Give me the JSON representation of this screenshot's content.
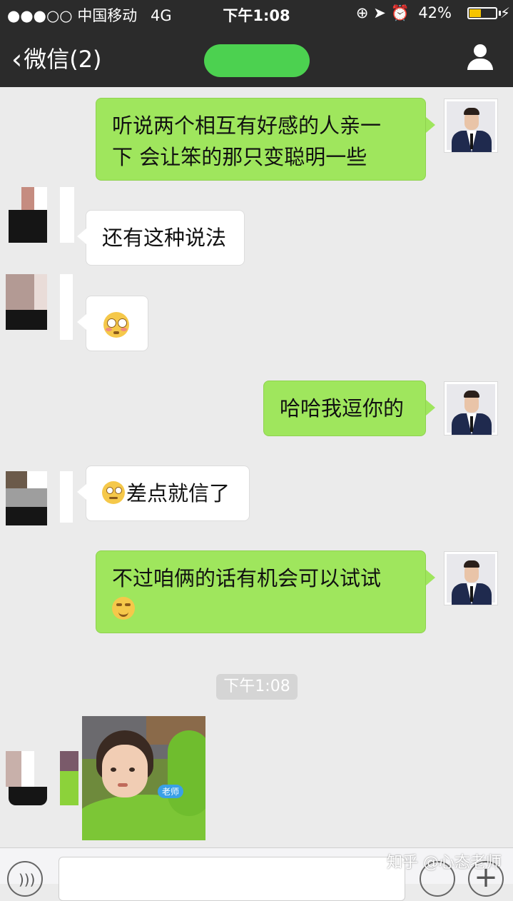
{
  "status_bar": {
    "signal": "●●●○○",
    "carrier": "中国移动",
    "network": "4G",
    "time": "下午1:08",
    "right_icons": "⊕ ➤ ⏰",
    "battery_percent": "42%",
    "battery_level": 0.42,
    "battery_color": "#f5c400"
  },
  "nav": {
    "back_label": "微信(2)",
    "back_icon": "chevron-left",
    "profile_icon": "person-icon"
  },
  "messages": [
    {
      "side": "me",
      "text_lines": [
        "听说两个相互有好感的人亲一",
        "下 会让笨的那只变聪明一些"
      ]
    },
    {
      "side": "them",
      "text": "还有这种说法"
    },
    {
      "side": "them",
      "emoji": "flushed-face"
    },
    {
      "side": "me",
      "text": "哈哈我逗你的"
    },
    {
      "side": "them",
      "text": "差点就信了",
      "emoji": "rolling-eyes-face"
    },
    {
      "side": "me",
      "text": "不过咱俩的话有机会可以试试",
      "emoji": "smirking-face"
    }
  ],
  "timestamp": "下午1:08",
  "photo": {
    "sticker_text": "老师"
  },
  "watermark": "知乎 @心态老师",
  "colors": {
    "green_bubble": "#9fe65d",
    "header": "#2b2b2b",
    "background": "#ebebeb"
  }
}
